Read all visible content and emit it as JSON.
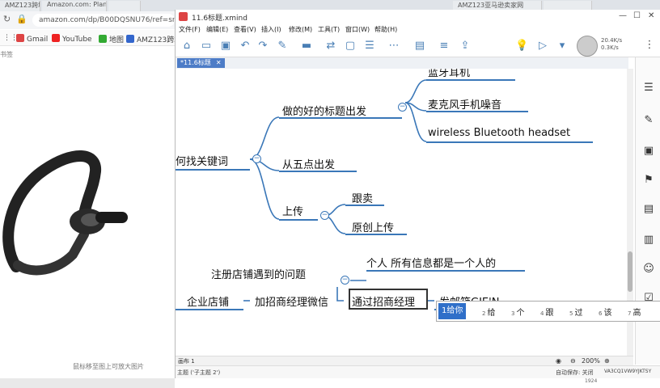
{
  "browser": {
    "tabs": [
      "AMZ123跨境卖家网",
      "Amazon.com: Plantron...",
      "",
      "AMZ123亚马逊卖家网",
      ""
    ],
    "url": "amazon.com/dp/B00DQSNU76/ref=sr_",
    "bookmarks": [
      "Gmail",
      "YouTube",
      "地图",
      "AMZ123跨境..."
    ],
    "side_text": "书签",
    "hover_hint": "鼠标移至图上可放大图片"
  },
  "xmind": {
    "title": "11.6标题.xmind",
    "menu": [
      "文件(F)",
      "编辑(E)",
      "查看(V)",
      "插入(I)",
      "修改(M)",
      "工具(T)",
      "窗口(W)",
      "帮助(H)"
    ],
    "net_speed": [
      "20.4K/s",
      "0.3K/s"
    ],
    "doc_tab": "*11.6标题",
    "topics": {
      "root1": "何找关键词",
      "b1": "做的好的标题出发",
      "b1_c0": "蓝牙耳机",
      "b1_c1": "麦克风手机噪音",
      "b1_c2": "wireless Bluetooth headset",
      "b2": "从五点出发",
      "b3": "上传",
      "b3_c1": "跟卖",
      "b3_c2": "原创上传",
      "root2": "企业店铺",
      "r2_a": "注册店铺遇到的问题",
      "r2_b": "加招商经理微信",
      "r2_c": "通过招商经理",
      "r2_c_note": "个人 所有信息都是一个人的",
      "r2_d": "发邮箱GIE'N"
    },
    "ime": {
      "first": "1给你",
      "candidates": [
        {
          "n": "2",
          "t": "给"
        },
        {
          "n": "3",
          "t": "个"
        },
        {
          "n": "4",
          "t": "跟"
        },
        {
          "n": "5",
          "t": "过"
        },
        {
          "n": "6",
          "t": "该"
        },
        {
          "n": "7",
          "t": "高"
        }
      ]
    },
    "sheet": "画布 1",
    "zoom": "200%",
    "status": {
      "topic": "主题 ('子主题 2')",
      "autosave": "自动保存: 关闭",
      "code": "VA3CQ1VW9YJKTSY",
      "time": "1924"
    }
  },
  "colors": {
    "accent": "#3a77b8",
    "ime_highlight": "#2f6fc9",
    "tab_active": "#4d7cc7"
  }
}
